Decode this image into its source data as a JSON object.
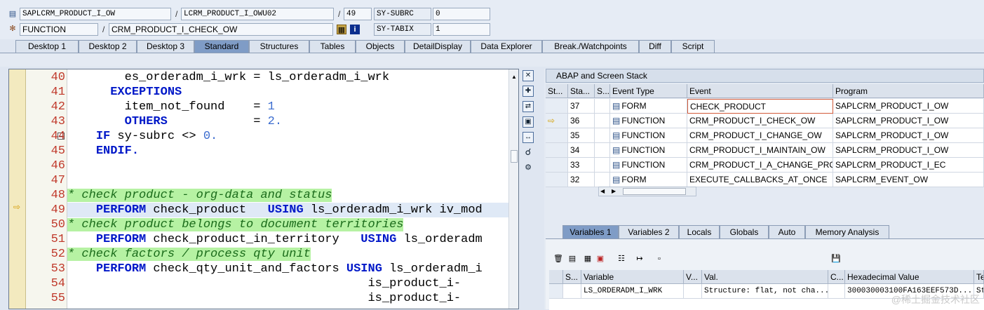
{
  "top": {
    "program": "SAPLCRM_PRODUCT_I_OW",
    "include": "LCRM_PRODUCT_I_OWU02",
    "line": "49",
    "sysubrc_label": "SY-SUBRC",
    "sysubrc_value": "0",
    "event_type": "FUNCTION",
    "event_name": "CRM_PRODUCT_I_CHECK_OW",
    "sytabix_label": "SY-TABIX",
    "sytabix_value": "1"
  },
  "tabs": [
    "Desktop 1",
    "Desktop 2",
    "Desktop 3",
    "Standard",
    "Structures",
    "Tables",
    "Objects",
    "DetailDisplay",
    "Data Explorer",
    "Break./Watchpoints",
    "Diff",
    "Script"
  ],
  "code": {
    "lines": [
      {
        "n": "40",
        "parts": [
          {
            "t": "        es_orderadm_i_wrk = ls_orderadm_i_wrk",
            "c": "plain"
          }
        ]
      },
      {
        "n": "41",
        "parts": [
          {
            "t": "      ",
            "c": "plain"
          },
          {
            "t": "EXCEPTIONS",
            "c": "kw"
          }
        ]
      },
      {
        "n": "42",
        "parts": [
          {
            "t": "        item_not_found    = ",
            "c": "plain"
          },
          {
            "t": "1",
            "c": "num"
          }
        ]
      },
      {
        "n": "43",
        "parts": [
          {
            "t": "        ",
            "c": "plain"
          },
          {
            "t": "OTHERS",
            "c": "kw"
          },
          {
            "t": "            = ",
            "c": "plain"
          },
          {
            "t": "2.",
            "c": "num"
          }
        ]
      },
      {
        "n": "44",
        "parts": [
          {
            "t": "    ",
            "c": "plain"
          },
          {
            "t": "IF",
            "c": "kw"
          },
          {
            "t": " sy-subrc <> ",
            "c": "plain"
          },
          {
            "t": "0.",
            "c": "num"
          }
        ]
      },
      {
        "n": "45",
        "parts": [
          {
            "t": "    ",
            "c": "plain"
          },
          {
            "t": "ENDIF.",
            "c": "kw"
          }
        ]
      },
      {
        "n": "46",
        "parts": []
      },
      {
        "n": "47",
        "parts": []
      },
      {
        "n": "48",
        "parts": [
          {
            "t": "* check product - org-data and status",
            "c": "cmt"
          }
        ]
      },
      {
        "n": "49",
        "parts": [
          {
            "t": "    ",
            "c": "plain"
          },
          {
            "t": "PERFORM",
            "c": "kw"
          },
          {
            "t": " check_product   ",
            "c": "plain"
          },
          {
            "t": "USING",
            "c": "kw"
          },
          {
            "t": " ls_orderadm_i_wrk iv_mod",
            "c": "plain"
          }
        ],
        "current": true
      },
      {
        "n": "50",
        "parts": [
          {
            "t": "* check product belongs to document territories",
            "c": "cmt"
          }
        ]
      },
      {
        "n": "51",
        "parts": [
          {
            "t": "    ",
            "c": "plain"
          },
          {
            "t": "PERFORM",
            "c": "kw"
          },
          {
            "t": " check_product_in_territory   ",
            "c": "plain"
          },
          {
            "t": "USING",
            "c": "kw"
          },
          {
            "t": " ls_orderadm",
            "c": "plain"
          }
        ]
      },
      {
        "n": "52",
        "parts": [
          {
            "t": "* check factors / process qty unit",
            "c": "cmt"
          }
        ]
      },
      {
        "n": "53",
        "parts": [
          {
            "t": "    ",
            "c": "plain"
          },
          {
            "t": "PERFORM",
            "c": "kw"
          },
          {
            "t": " check_qty_unit_and_factors ",
            "c": "plain"
          },
          {
            "t": "USING",
            "c": "kw"
          },
          {
            "t": " ls_orderadm_i",
            "c": "plain"
          }
        ]
      },
      {
        "n": "54",
        "parts": [
          {
            "t": "                                          is_product_i-",
            "c": "plain"
          }
        ]
      },
      {
        "n": "55",
        "parts": [
          {
            "t": "                                          is_product_i-",
            "c": "plain"
          }
        ]
      }
    ]
  },
  "stack": {
    "title": "ABAP and Screen Stack",
    "columns": [
      "St...",
      "Sta...",
      "S...",
      "Event Type",
      "Event",
      "Program"
    ],
    "rows": [
      {
        "level": "37",
        "type": "FORM",
        "event": "CHECK_PRODUCT",
        "program": "SAPLCRM_PRODUCT_I_OW",
        "current": false
      },
      {
        "level": "36",
        "type": "FUNCTION",
        "event": "CRM_PRODUCT_I_CHECK_OW",
        "program": "SAPLCRM_PRODUCT_I_OW",
        "current": true
      },
      {
        "level": "35",
        "type": "FUNCTION",
        "event": "CRM_PRODUCT_I_CHANGE_OW",
        "program": "SAPLCRM_PRODUCT_I_OW",
        "current": false
      },
      {
        "level": "34",
        "type": "FUNCTION",
        "event": "CRM_PRODUCT_I_MAINTAIN_OW",
        "program": "SAPLCRM_PRODUCT_I_OW",
        "current": false
      },
      {
        "level": "33",
        "type": "FUNCTION",
        "event": "CRM_PRODUCT_I_A_CHANGE_PROD.",
        "program": "SAPLCRM_PRODUCT_I_EC",
        "current": false
      },
      {
        "level": "32",
        "type": "FORM",
        "event": "EXECUTE_CALLBACKS_AT_ONCE",
        "program": "SAPLCRM_EVENT_OW",
        "current": false
      }
    ]
  },
  "var_tabs": [
    "Variables 1",
    "Variables 2",
    "Locals",
    "Globals",
    "Auto",
    "Memory Analysis"
  ],
  "vars": {
    "columns": [
      "S...",
      "Variable",
      "V...",
      "Val.",
      "C...",
      "Hexadecimal Value",
      "Te"
    ],
    "rows": [
      {
        "variable": "LS_ORDERADM_I_WRK",
        "value": "Structure: flat, not cha...",
        "hex": "300030003100FA163EEF573D...",
        "te": "Str"
      }
    ]
  },
  "watermark": "@稀土掘金技术社区"
}
